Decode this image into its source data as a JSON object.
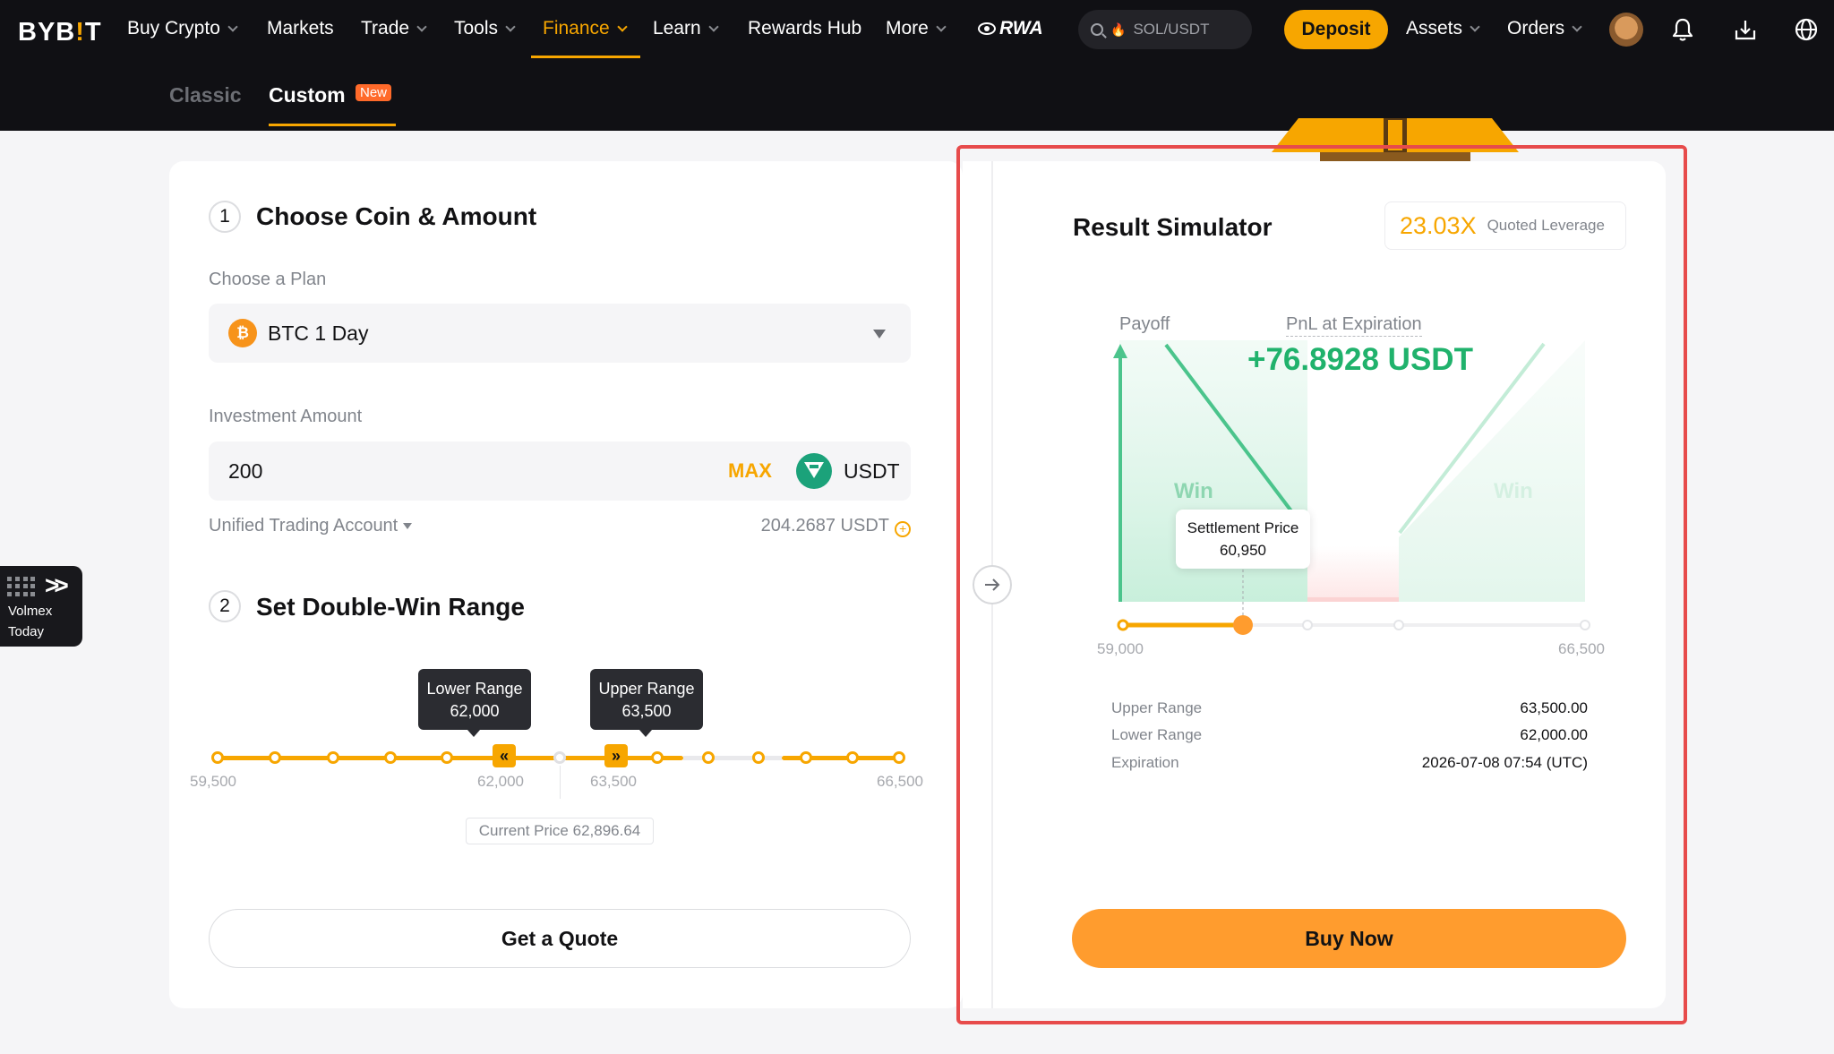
{
  "nav": {
    "logo_main": "BYB",
    "logo_bang": "!",
    "logo_end": "T",
    "items": [
      {
        "label": "Buy Crypto"
      },
      {
        "label": "Markets"
      },
      {
        "label": "Trade"
      },
      {
        "label": "Tools"
      },
      {
        "label": "Finance"
      },
      {
        "label": "Learn"
      },
      {
        "label": "Rewards Hub"
      },
      {
        "label": "More"
      }
    ],
    "rwa": "RWA",
    "search_text": "SOL/USDT",
    "deposit": "Deposit",
    "assets": "Assets",
    "orders": "Orders"
  },
  "subnav": {
    "classic": "Classic",
    "custom": "Custom",
    "new_badge": "New"
  },
  "step1": {
    "num": "1",
    "title": "Choose Coin & Amount",
    "plan_label": "Choose a Plan",
    "plan_coin": "₿",
    "plan_value": "BTC  1 Day",
    "amount_label": "Investment Amount",
    "amount_value": "200",
    "max": "MAX",
    "currency": "USDT",
    "account": "Unified Trading Account",
    "balance": "204.2687 USDT"
  },
  "step2": {
    "num": "2",
    "title": "Set Double-Win Range",
    "lower_tip_label": "Lower Range",
    "lower_tip_value": "62,000",
    "upper_tip_label": "Upper Range",
    "upper_tip_value": "63,500",
    "lower_handle": "«",
    "upper_handle": "»",
    "axis": [
      "59,500",
      "62,000",
      "63,500",
      "66,500"
    ],
    "current_price": "Current Price 62,896.64",
    "quote_btn": "Get a Quote"
  },
  "simulator": {
    "title": "Result Simulator",
    "leverage_value": "23.03X",
    "leverage_label": "Quoted Leverage",
    "payoff": "Payoff",
    "pnl_label": "PnL at Expiration",
    "pnl_value": "+76.8928 USDT",
    "win_left": "Win",
    "win_right": "Win",
    "settle_label": "Settlement Price",
    "settle_value": "60,950",
    "axis_min": "59,000",
    "axis_max": "66,500",
    "settle_fraction": 0.26,
    "upper_label": "Upper Range",
    "upper_value": "63,500.00",
    "lower_label": "Lower Range",
    "lower_value": "62,000.00",
    "exp_label": "Expiration",
    "exp_value": "2026-07-08 07:54 (UTC)",
    "buy_btn": "Buy Now"
  },
  "volmex": {
    "line1": "Volmex",
    "line2": "Today"
  },
  "colors": {
    "accent": "#f7a600",
    "win_green": "#20b26c",
    "outline_red": "#e74b4b"
  }
}
